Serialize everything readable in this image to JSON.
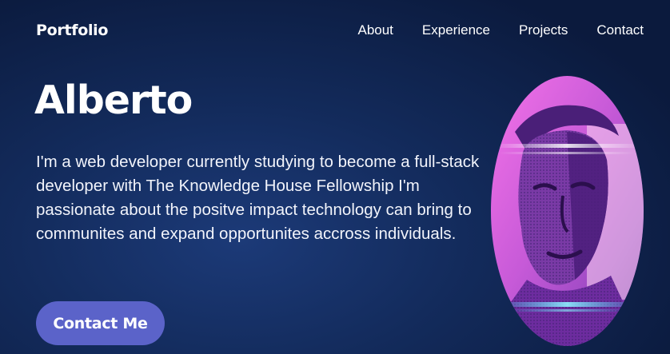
{
  "header": {
    "brand": "Portfolio",
    "nav": [
      "About",
      "Experience",
      "Projects",
      "Contact"
    ]
  },
  "hero": {
    "name": "Alberto",
    "bio": "I'm a web developer currently studying to become a full-stack developer with The Knowledge House Fellowship I'm passionate about the positve impact technology can bring to communites and expand opportunites accross individuals.",
    "cta_label": "Contact Me"
  },
  "colors": {
    "background": "#132b5c",
    "button": "#5b63c9",
    "portrait_pink": "#f36fe6",
    "portrait_purple": "#6c2a9c"
  },
  "icons": {
    "portrait": "profile-photo"
  }
}
